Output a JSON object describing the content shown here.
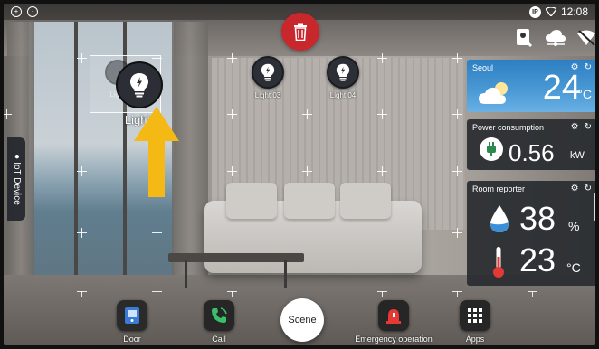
{
  "status_bar": {
    "ip_badge": "IP",
    "time": "12:08"
  },
  "side_tab": {
    "label": "IoT Device"
  },
  "devices": {
    "ghost_label": "Light",
    "dragged_label": "Light",
    "light_03": "Light 03",
    "light_04": "Light 04"
  },
  "widgets": {
    "weather": {
      "city": "Seoul",
      "temperature": "24",
      "unit": "°C"
    },
    "power": {
      "title": "Power consumption",
      "value": "0.56",
      "unit": "kW"
    },
    "room": {
      "title": "Room reporter",
      "humidity": "38",
      "humidity_unit": "%",
      "temperature": "23",
      "temperature_unit": "°C"
    }
  },
  "dock": {
    "door": "Door",
    "call": "Call",
    "scene": "Scene",
    "emergency": "Emergency operation",
    "apps": "Apps"
  },
  "colors": {
    "delete": "#c8272c",
    "arrow": "#f5b915",
    "weather_sky": "#2d7fc2"
  }
}
